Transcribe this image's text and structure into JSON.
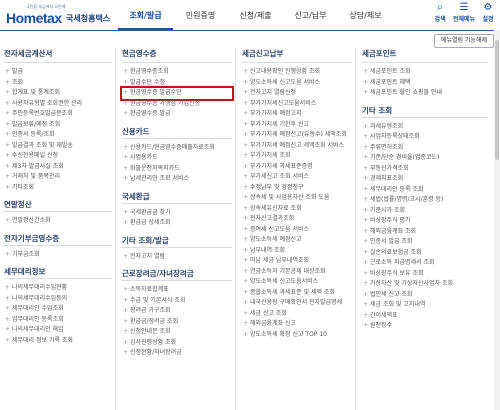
{
  "logo": {
    "sub": "국민을 세금에서 국민께",
    "word": "Hometax",
    "kr": "국세청홈택스"
  },
  "nav": [
    "조회/발급",
    "민원증명",
    "신청/제출",
    "신고/납부",
    "상담/제보"
  ],
  "utils": [
    {
      "icon": "⌕",
      "label": "검색"
    },
    {
      "icon": "☰",
      "label": "전체메뉴"
    },
    {
      "icon": "⚙",
      "label": "설정"
    }
  ],
  "func_button": "메뉴열림 기능해제",
  "col1": {
    "title": "전자세금계산서",
    "items": [
      "발급",
      "조회",
      "합계표 및 통계조회",
      "사용자유형별 조회권한 관리",
      "주민등록번호발급분조회",
      "발급보류/예정 조회",
      "인증서 등록/조회",
      "발급결과 조회 및 재발송",
      "수신전용메일 신청",
      "제3자 발급사실 조회",
      "거래처 및 품목관리",
      "기타조회"
    ],
    "sec2": "연말정산",
    "sec2_items": [
      "연말정산간소화"
    ],
    "sec3": "전자기부금영수증",
    "sec3_items": [
      "기부금조회"
    ],
    "sec4": "세무대리정보",
    "sec4_items": [
      "나의세무대리수임현황",
      "나의세무대리수임동의",
      "세무대리인 수임조회",
      "업무대리인 등록조회",
      "나의세무대리인 해임",
      "세무대리 정보 기록 조회"
    ]
  },
  "col2": {
    "title": "현금영수증",
    "items": [
      "현금영수증조회",
      "발급수단 수정",
      "현금영수증 발급수단",
      "현금영수증 가맹점 가입신청",
      "현금영수증 발급"
    ],
    "sec2": "신용카드",
    "sec2_items": [
      "신용카드/현금영수증매출자료조회",
      "사업용카드",
      "화물운전자복지카드",
      "납세관리인 조회 서비스"
    ],
    "sec3": "국세환급",
    "sec3_items": [
      "국세환급금 찾기",
      "환급금 상세조회"
    ],
    "sec4": "기타 조회/발급",
    "sec4_items": [
      "전자고지 열람"
    ],
    "sec5": "근로장려금/자녀장려금",
    "sec5_items": [
      "소득자료합계표",
      "수급 및 기본서식 조회",
      "장려금 가구조회",
      "환급금/장려금 조회",
      "신청안내문 조회",
      "심사진행상황 조회",
      "신청현황/자녀장려금"
    ]
  },
  "col3": {
    "title": "세금신고납부",
    "items": [
      "신고내용확인 진행상황 조회",
      "양도소득세 신고도움 서비스",
      "전자고지 열람신청",
      "부가가치세신고도움서비스",
      "부가가치세 예정고지",
      "부가가치세 기한후 신고",
      "부가가치세 예정신고(유동수) 세액조회",
      "부가가치세 예정신고 세액조회 서비스",
      "부가가치세 조회",
      "부가가치세 과세표준증명",
      "부가세신고 조회 서비스",
      "수정납부 및 경정청구",
      "상속세 및 사업용자산 조회 도움",
      "상속세유산자료 조회",
      "전자신고결과조회",
      "증여세 신고도움 서비스",
      "양도소득세 예정신고",
      "납부내역 조회",
      "미납 세금 납부내역조회",
      "연금소득자 기본공제 대상조회",
      "양도소득세 신고도움서비스",
      "종합소득세 과세표준 및 세액 조회",
      "내국신용장 구매확인서 전자발급명세",
      "세금 신고 조회",
      "해외금융계좌 신고",
      "양도소득세 확정 신고 TOP 10"
    ],
    "sec2": "",
    "sec2_items": []
  },
  "col4": {
    "title": "세금포인트",
    "items": [
      "세금포인트 조회",
      "세금포인트 혜택",
      "세금포인트 할인 쇼핑몰 안내"
    ],
    "sec2": "기타 조회",
    "sec2_items": [
      "과세유형조회",
      "사업자등록상태조회",
      "주류면허조회",
      "기준/단순 경비율(업종코드)",
      "부동산가격조회",
      "경제지표조회",
      "세무대리인 등록 조회",
      "세법(법률/명령/고시/훈령 등)",
      "기준시가 조회",
      "비상장주식 평가",
      "해외금융계좌 조회",
      "인증서 발급 조회",
      "실손의료보험금 조회",
      "근로소득 지급명세서 조회",
      "비상장주식 보유 조회",
      "가상자산 및 가상자산사업자 조회",
      "법인세 신고 조회",
      "세금 조회 및 고지내역",
      "간이세액표",
      "원천징수"
    ]
  }
}
